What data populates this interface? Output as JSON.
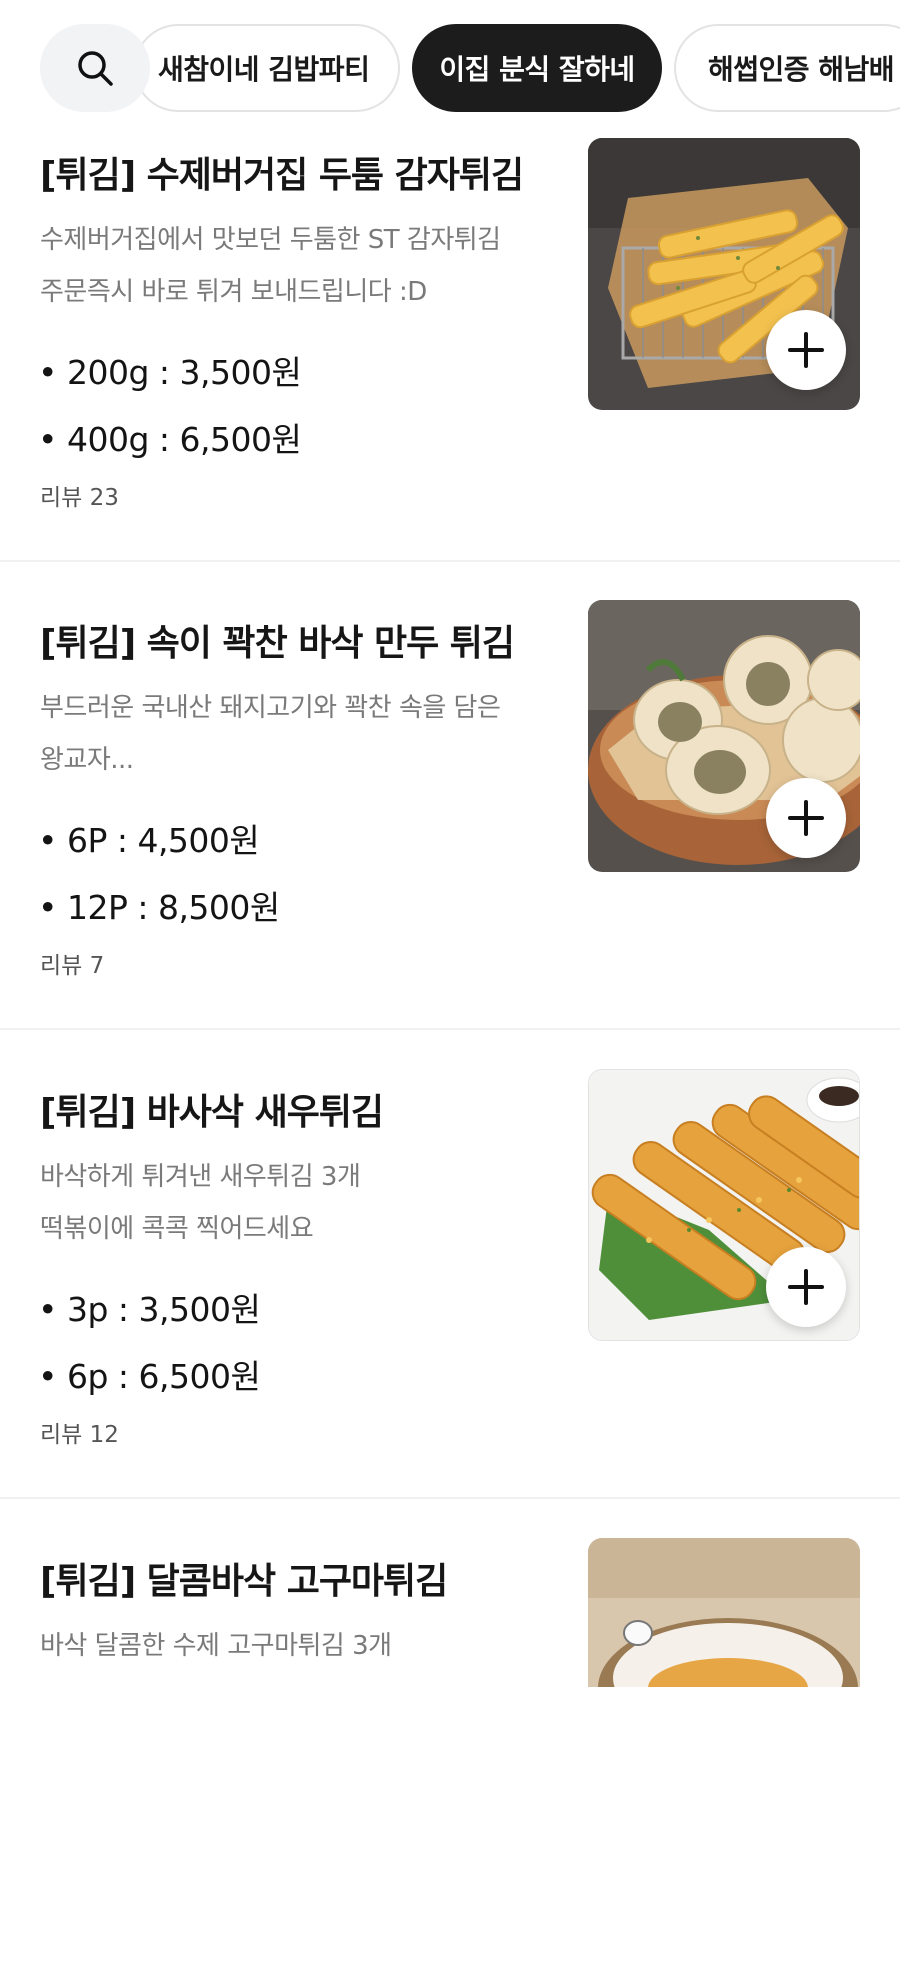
{
  "categories": {
    "search_icon": "search-icon",
    "chips": [
      {
        "label": "새참이네 김밥파티"
      },
      {
        "label": "이집 분식 잘하네",
        "active": true
      },
      {
        "label": "해썹인증 해남배"
      }
    ]
  },
  "menu": [
    {
      "title": "[튀김] 수제버거집 두툼 감자튀김",
      "desc": [
        "수제버거집에서 맛보던 두툼한 ST 감자튀김",
        "주문즉시 바로 튀겨 보내드립니다 :D"
      ],
      "prices": [
        "• 200g : 3,500원",
        "• 400g : 6,500원"
      ],
      "review": "리뷰 23",
      "photo": "french-fries-basket"
    },
    {
      "title": "[튀김] 속이 꽉찬 바삭 만두 튀김",
      "desc": [
        "부드러운 국내산 돼지고기와 꽉찬 속을 담은",
        "왕교자..."
      ],
      "prices": [
        "• 6P : 4,500원",
        "• 12P : 8,500원"
      ],
      "review": "리뷰 7",
      "photo": "fried-dumplings-bowl"
    },
    {
      "title": "[튀김] 바사삭 새우튀김",
      "desc": [
        "바삭하게 튀겨낸 새우튀김 3개",
        "떡볶이에 콕콕 찍어드세요"
      ],
      "prices": [
        "• 3p : 3,500원",
        "• 6p : 6,500원"
      ],
      "review": "리뷰 12",
      "photo": "fried-shrimp-plate"
    },
    {
      "title": "[튀김] 달콤바삭 고구마튀김",
      "desc": [
        "바삭 달콤한 수제 고구마튀김 3개"
      ],
      "prices": [],
      "review": "",
      "photo": "sweet-potato-fritters"
    }
  ],
  "colors": {
    "active_chip": "#1c1c1c",
    "title": "#161616",
    "desc": "#7a7a7a"
  }
}
